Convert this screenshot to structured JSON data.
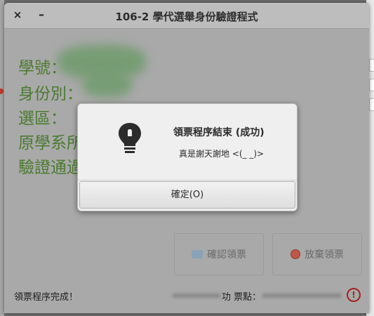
{
  "window": {
    "title": "106-2 學代選舉身份驗證程式",
    "close_glyph": "×",
    "minimize_glyph": "–"
  },
  "info": {
    "student_id_label": "學號：",
    "identity_label": "身份別：",
    "district_label": "選區：",
    "original_dept_label": "原學系所",
    "verify_label": "驗證通過"
  },
  "buttons": {
    "confirm_label": "確認領票",
    "abandon_label": "放棄領票"
  },
  "status": {
    "message": "領票程序完成！",
    "ticket_text": "功 票點："
  },
  "dialog": {
    "title": "領票程序結束 (成功)",
    "message": "真是謝天謝地 <(_ _)>",
    "ok_label": "確定(O)"
  },
  "colors": {
    "info_text": "#4b7a30",
    "warning": "#a52020"
  }
}
